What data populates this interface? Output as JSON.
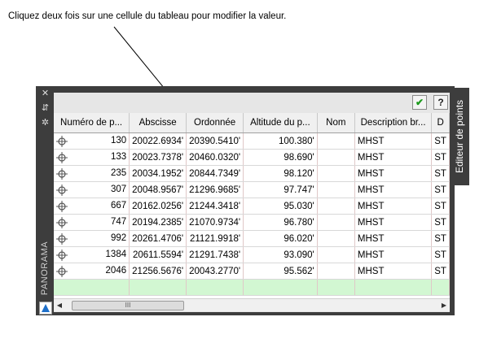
{
  "instruction": "Cliquez deux fois sur une cellule du tableau pour modifier la valeur.",
  "panel": {
    "title": "PANORAMA",
    "tab": "Editeur de points",
    "leftbar_icons": [
      "close-icon",
      "autohide-icon",
      "properties-icon"
    ],
    "toolbar": {
      "apply_glyph": "✔",
      "help_glyph": "?"
    }
  },
  "table": {
    "columns": [
      "Numéro de p...",
      "Abscisse",
      "Ordonnée",
      "Altitude du p...",
      "Nom",
      "Description br...",
      "D"
    ],
    "rows": [
      {
        "num": "130",
        "x": "20022.6934'",
        "y": "20390.5410'",
        "z": "100.380'",
        "name": "",
        "desc": "MHST",
        "d": "ST"
      },
      {
        "num": "133",
        "x": "20023.7378'",
        "y": "20460.0320'",
        "z": "98.690'",
        "name": "",
        "desc": "MHST",
        "d": "ST"
      },
      {
        "num": "235",
        "x": "20034.1952'",
        "y": "20844.7349'",
        "z": "98.120'",
        "name": "",
        "desc": "MHST",
        "d": "ST"
      },
      {
        "num": "307",
        "x": "20048.9567'",
        "y": "21296.9685'",
        "z": "97.747'",
        "name": "",
        "desc": "MHST",
        "d": "ST"
      },
      {
        "num": "667",
        "x": "20162.0256'",
        "y": "21244.3418'",
        "z": "95.030'",
        "name": "",
        "desc": "MHST",
        "d": "ST"
      },
      {
        "num": "747",
        "x": "20194.2385'",
        "y": "21070.9734'",
        "z": "96.780'",
        "name": "",
        "desc": "MHST",
        "d": "ST"
      },
      {
        "num": "992",
        "x": "20261.4706'",
        "y": "21121.9918'",
        "z": "96.020'",
        "name": "",
        "desc": "MHST",
        "d": "ST"
      },
      {
        "num": "1384",
        "x": "20611.5594'",
        "y": "21291.7438'",
        "z": "93.090'",
        "name": "",
        "desc": "MHST",
        "d": "ST"
      },
      {
        "num": "2046",
        "x": "21256.5676'",
        "y": "20043.2770'",
        "z": "95.562'",
        "name": "",
        "desc": "MHST",
        "d": "ST"
      }
    ]
  },
  "scrollbar": {
    "left_arrow": "◀",
    "right_arrow": "▶",
    "thumb_grip": "III"
  },
  "colors": {
    "panel_bg": "#3d3d3d",
    "new_row": "#d2f7d2"
  }
}
